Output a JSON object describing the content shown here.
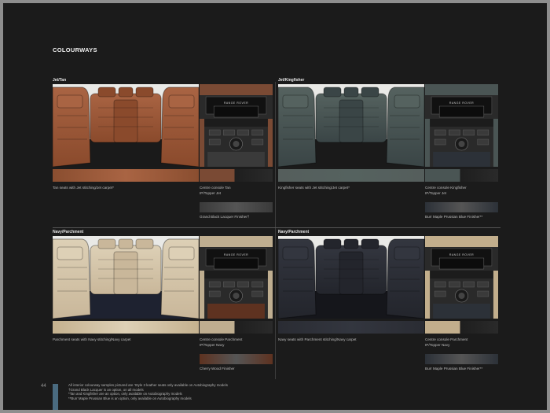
{
  "page": {
    "title": "COLOURWAYS",
    "page_number": "44"
  },
  "sections": [
    {
      "name": "Jet/Tan",
      "seat_caption": "Tan seats with Jet stitching/Jet carpet*",
      "console_caption_1": "Centre console Tan",
      "console_caption_2": "IP/Topper Jet",
      "finish_caption": "Grand Black Lacquer Finisher†",
      "brand_badge": "RANGE ROVER",
      "colors": {
        "seat": "#8a4a2c",
        "seat_light": "#a96443",
        "carpet": "#1a1a1a",
        "trim": "#7a4a34",
        "finish": "#3a3a3a",
        "strip": "#8a4e30"
      }
    },
    {
      "name": "Jet/Kingfisher",
      "seat_caption": "Kingfisher seats with Jet stitching/Jet carpet*",
      "console_caption_1": "Centre console Kingfisher",
      "console_caption_2": "IP/Topper Jet",
      "finish_caption": "Burr Maple Prussian Blue Finisher**",
      "brand_badge": "RANGE ROVER",
      "colors": {
        "seat": "#3a4546",
        "seat_light": "#55625f",
        "carpet": "#1a1a1a",
        "trim": "#4a5554",
        "finish": "#2c3138",
        "strip": "#555e5c"
      }
    },
    {
      "name": "Navy/Parchment",
      "seat_caption": "Parchment seats with Navy stitching/Navy carpet",
      "console_caption_1": "Centre console Parchment",
      "console_caption_2": "IP/Topper Navy",
      "finish_caption": "Cherry Wood Finisher",
      "brand_badge": "RANGE ROVER",
      "colors": {
        "seat": "#c9b79a",
        "seat_light": "#ddd0b6",
        "carpet": "#1e2230",
        "trim": "#bfae90",
        "finish": "#5e3220",
        "strip": "#c5b28f"
      }
    },
    {
      "name": "Navy/Parchment",
      "seat_caption": "Navy seats with Parchment stitching/Navy carpet",
      "console_caption_1": "Centre console Parchment",
      "console_caption_2": "IP/Topper Navy",
      "finish_caption": "Burr Maple Prussian Blue Finisher**",
      "brand_badge": "RANGE ROVER",
      "colors": {
        "seat": "#23252c",
        "seat_light": "#33363f",
        "carpet": "#15161b",
        "trim": "#c2ae8c",
        "finish": "#2c3138",
        "strip": "#2a2c33"
      }
    }
  ],
  "footnotes": [
    "All interior colourway samples pictured are 'Style 3 leather seats only available on Autobiography models",
    "†Grand Black Lacquer is an option, on all models",
    "*Tan and Kingfisher are an option, only available on Autobiography models",
    "**Burr Maple Prussian Blue is an option, only available on Autobiography models"
  ]
}
